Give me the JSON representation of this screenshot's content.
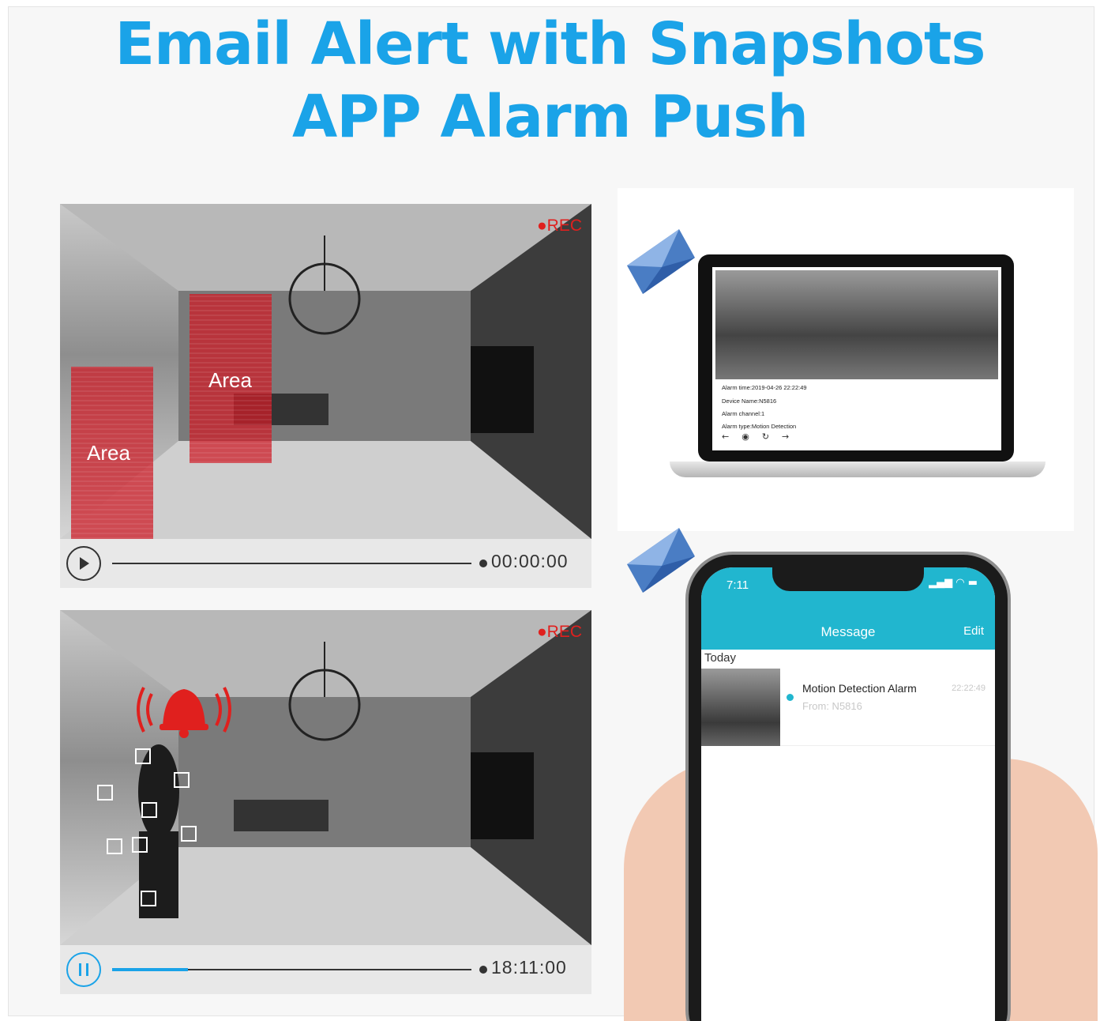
{
  "headline": {
    "line1": "Email Alert with Snapshots",
    "line2": "APP Alarm Push"
  },
  "camera_top": {
    "rec_label": "●REC",
    "areas": [
      "Area",
      "Area"
    ],
    "time": "00:00:00",
    "progress": 0
  },
  "camera_bottom": {
    "rec_label": "●REC",
    "time": "18:11:00",
    "progress": 0.21
  },
  "email": {
    "alarm_time": "Alarm time:2019-04-26   22:22:49",
    "device_name": "Device Name:N5816",
    "alarm_channel": "Alarm channel:1",
    "alarm_type": "Alarm type:Motion Detection"
  },
  "phone": {
    "status_time": "7:11",
    "title": "Message",
    "edit_label": "Edit",
    "section": "Today",
    "message": {
      "title": "Motion Detection Alarm",
      "time": "22:22:49",
      "from": "From: N5816"
    }
  },
  "colors": {
    "headline": "#1aa3e8",
    "area_red": "#cd1e28",
    "app_teal": "#21b6cf",
    "envelope_blue": "#4a7dc4"
  }
}
